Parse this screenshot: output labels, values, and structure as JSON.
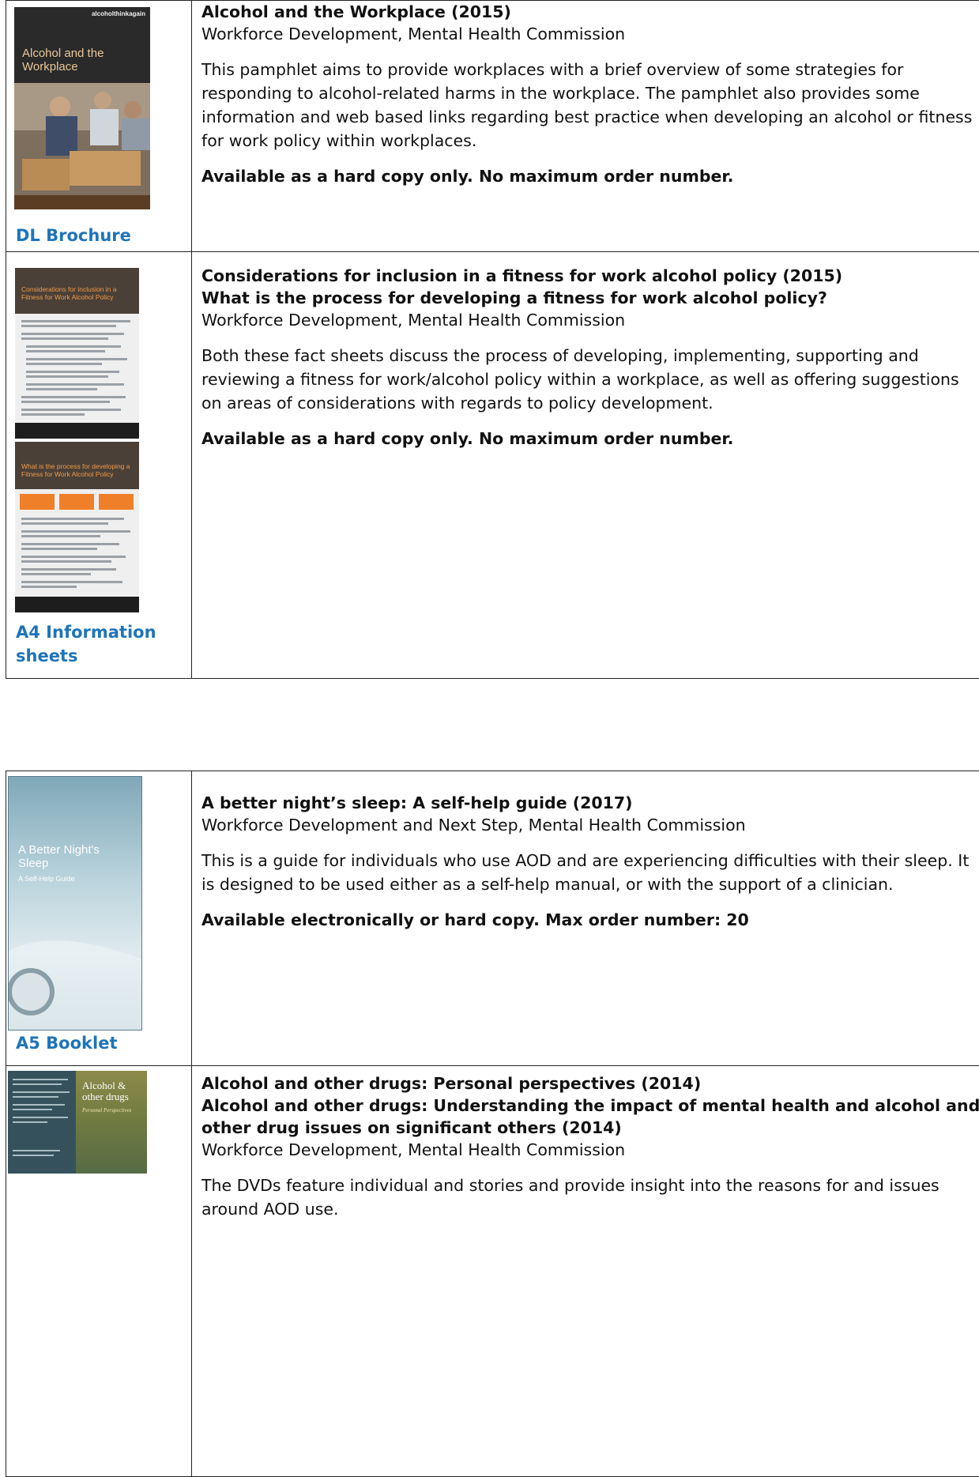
{
  "table1": {
    "rows": [
      {
        "type_label": "DL Brochure",
        "cover": {
          "brand": "alcoholthinkagain",
          "title": "Alcohol and the Workplace"
        },
        "titles": [
          "Alcohol and the Workplace (2015)"
        ],
        "author": "Workforce Development, Mental Health Commission",
        "description": "This pamphlet aims to provide workplaces with a brief overview of some strategies for responding to alcohol-related harms in the workplace.  The pamphlet also provides some information and web based links regarding best practice when developing an alcohol or fitness for work policy within workplaces.",
        "availability": "Available as a hard copy only. No maximum order number."
      },
      {
        "type_label": "A4 Information sheets",
        "cover": {
          "title_1": "Considerations for inclusion in a Fitness for Work Alcohol Policy",
          "title_2": "What is the process for developing a Fitness for Work Alcohol Policy"
        },
        "titles": [
          "Considerations for inclusion in a fitness for work alcohol policy (2015)",
          "What is the process for developing a fitness for work alcohol policy?"
        ],
        "author": "Workforce Development, Mental Health Commission",
        "description": "Both these fact sheets discuss the process of developing, implementing, supporting and reviewing a fitness for work/alcohol policy within a workplace, as well as offering suggestions on areas of considerations with regards to policy development.",
        "availability": "Available as a hard copy only. No maximum order number."
      }
    ]
  },
  "table2": {
    "rows": [
      {
        "type_label": "A5 Booklet",
        "cover": {
          "title": "A Better Night's Sleep",
          "subtitle": "A Self-Help Guide"
        },
        "titles": [
          "A better night’s sleep: A self-help guide (2017)"
        ],
        "author": "Workforce Development and Next Step, Mental Health Commission",
        "description": "This is a guide for individuals who use AOD and are experiencing difficulties with their sleep. It is designed to be used either as a self-help manual, or with the support of a clinician.",
        "availability": "Available electronically or hard copy. Max order number: 20"
      },
      {
        "type_label": "",
        "cover": {
          "title": "Alcohol & other drugs",
          "subtitle": "Personal Perspectives"
        },
        "titles": [
          "Alcohol and other drugs: Personal perspectives (2014)",
          "Alcohol and other drugs: Understanding the impact of mental health and alcohol and other drug issues on significant others (2014)"
        ],
        "author": "Workforce Development, Mental Health Commission",
        "description": "The DVDs feature individual and stories and provide insight into the reasons for and issues around AOD use.",
        "availability": ""
      }
    ]
  },
  "colors": {
    "label_blue": "#1f74b8",
    "border": "#222222"
  }
}
